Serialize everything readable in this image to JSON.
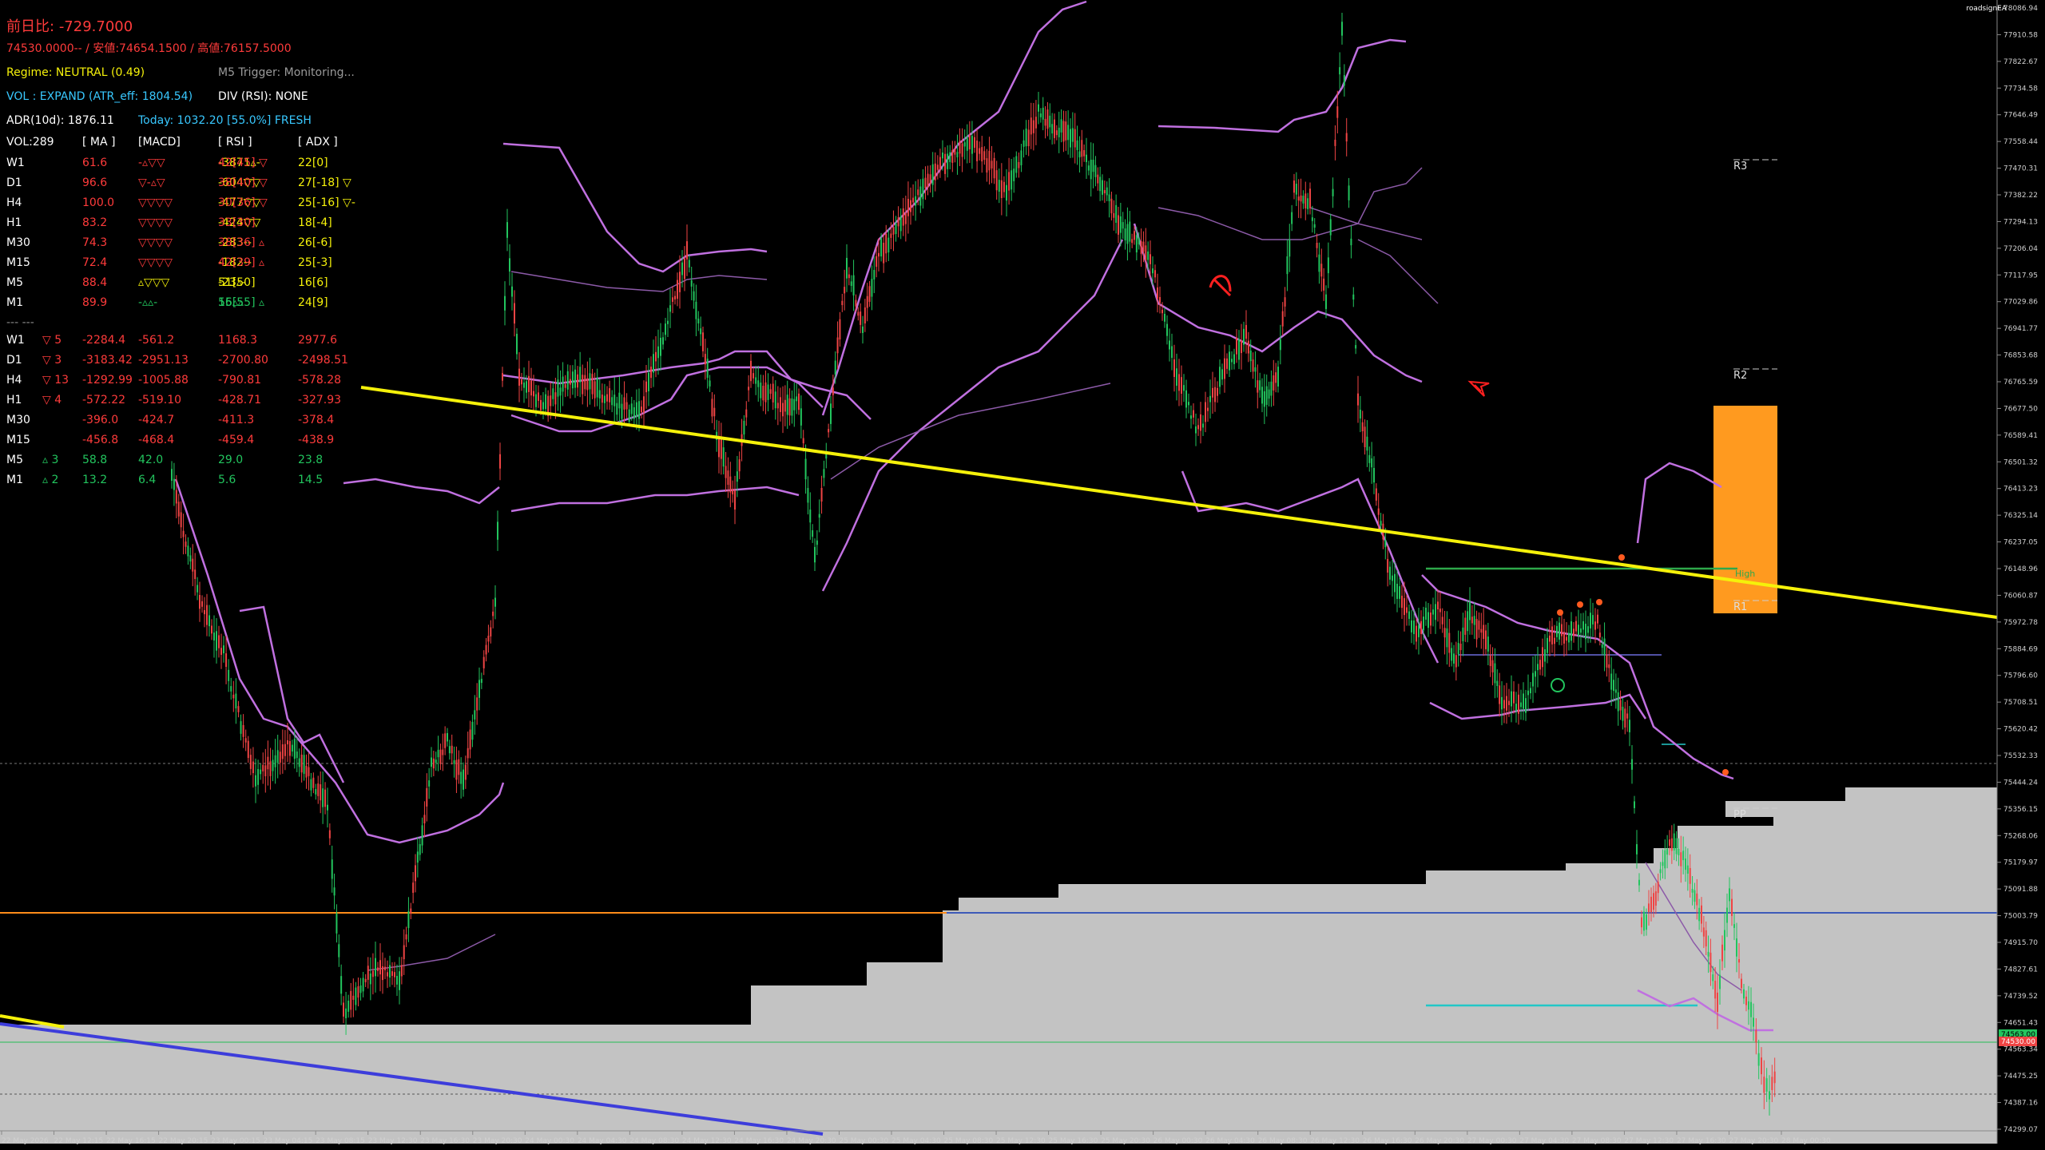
{
  "hud": {
    "change_label": "前日比:",
    "change_value": "-729.7000",
    "price_line": "74530.0000--   / 安値:74654.1500 / 高値:76157.5000",
    "regime": "Regime: NEUTRAL (0.49)",
    "m5_trigger": "M5 Trigger: Monitoring...",
    "vol": "VOL : EXPAND (ATR_eff: 1804.54)",
    "div": "DIV (RSI): NONE",
    "adr_label": "ADR(10d):",
    "adr_value": "1876.11",
    "today": "Today: 1032.20 [55.0%] FRESH"
  },
  "table": {
    "header": [
      "VOL:289",
      "[ MA ]",
      "[MACD]",
      "[ RSI ]",
      "[ ADX ]"
    ],
    "rows1": [
      {
        "tf": "W1",
        "vol": "61.6",
        "ma": "-▵▽▽",
        "macd": "-3871▵-",
        "rsi": "42[45] ▽",
        "adx": "22[0]"
      },
      {
        "tf": "D1",
        "vol": "96.6",
        "ma": "▽-▵▽",
        "macd": "-604▽▽",
        "rsi": "38[40] ▽",
        "adx": "27[-18] ▽"
      },
      {
        "tf": "H4",
        "vol": "100.0",
        "ma": "▽▽▽▽",
        "macd": "-477▽▽",
        "rsi": "30[36] ▽",
        "adx": "25[-16] ▽-"
      },
      {
        "tf": "H1",
        "vol": "83.2",
        "ma": "▽▽▽▽",
        "macd": "-424▽▽",
        "rsi": "33[30]",
        "adx": "18[-4]"
      },
      {
        "tf": "M30",
        "vol": "74.3",
        "ma": "▽▽▽▽",
        "macd": "-283--",
        "rsi": "38[36] ▵",
        "adx": "26[-6]"
      },
      {
        "tf": "M15",
        "vol": "72.4",
        "ma": "▽▽▽▽",
        "macd": "-182--",
        "rsi": "42[39] ▵",
        "adx": "25[-3]"
      },
      {
        "tf": "M5",
        "vol": "88.4",
        "ma": "▵▽▽▽",
        "macd": "-23▵-",
        "rsi": "51[50]",
        "adx": "16[6]"
      },
      {
        "tf": "M1",
        "vol": "89.9",
        "ma": "-▵▵-",
        "macd": "15▵▵",
        "rsi": "56[55] ▵",
        "adx": "24[9]"
      }
    ],
    "sep": "--- ---",
    "rows2": [
      {
        "tf": "W1",
        "cnt": "▽ 5",
        "a": "-2284.4",
        "b": "-561.2",
        "c": "1168.3",
        "d": "2977.6"
      },
      {
        "tf": "D1",
        "cnt": "▽ 3",
        "a": "-3183.42",
        "b": "-2951.13",
        "c": "-2700.80",
        "d": "-2498.51"
      },
      {
        "tf": "H4",
        "cnt": "▽ 13",
        "a": "-1292.99",
        "b": "-1005.88",
        "c": "-790.81",
        "d": "-578.28"
      },
      {
        "tf": "H1",
        "cnt": "▽ 4",
        "a": "-572.22",
        "b": "-519.10",
        "c": "-428.71",
        "d": "-327.93"
      },
      {
        "tf": "M30",
        "cnt": "",
        "a": "-396.0",
        "b": "-424.7",
        "c": "-411.3",
        "d": "-378.4"
      },
      {
        "tf": "M15",
        "cnt": "",
        "a": "-456.8",
        "b": "-468.4",
        "c": "-459.4",
        "d": "-438.9"
      },
      {
        "tf": "M5",
        "cnt": "▵ 3",
        "a": "58.8",
        "b": "42.0",
        "c": "29.0",
        "d": "23.8"
      },
      {
        "tf": "M1",
        "cnt": "▵ 2",
        "a": "13.2",
        "b": "6.4",
        "c": "5.6",
        "d": "14.5"
      }
    ]
  },
  "corner_tag": "roadsignEA",
  "price_axis": [
    "78086.94",
    "77910.58",
    "77822.67",
    "77734.58",
    "77646.49",
    "77558.44",
    "77470.31",
    "77382.22",
    "77294.13",
    "77206.04",
    "77117.95",
    "77029.86",
    "76941.77",
    "76853.68",
    "76765.59",
    "76677.50",
    "76589.41",
    "76501.32",
    "76413.23",
    "76325.14",
    "76237.05",
    "76148.96",
    "76060.87",
    "75972.78",
    "75884.69",
    "75796.60",
    "75708.51",
    "75620.42",
    "75532.33",
    "75444.24",
    "75356.15",
    "75268.06",
    "75179.97",
    "75091.88",
    "75003.79",
    "74915.70",
    "74827.61",
    "74739.52",
    "74651.43",
    "74563.34",
    "74475.25",
    "74387.16",
    "74299.07"
  ],
  "current_price_tags": [
    "74563.00",
    "74530.00"
  ],
  "time_axis": [
    "22 May 2026",
    "22 May 12:15",
    "22 May 16:15",
    "22 May 20:15",
    "23 May 00:15",
    "23 May 04:15",
    "23 May 08:15",
    "23 May 12:30",
    "23 May 16:30",
    "23 May 20:30",
    "24 May 00:30",
    "24 May 04:30",
    "24 May 08:30",
    "24 May 12:30",
    "24 May 16:30",
    "24 May 20:30",
    "25 May 00:30",
    "25 May 04:30",
    "25 May 08:30",
    "25 May 12:30",
    "25 May 16:30",
    "25 May 20:30",
    "26 May 00:30",
    "26 May 04:30",
    "26 May 08:30",
    "26 May 12:30",
    "26 May 16:30",
    "26 May 20:30",
    "27 May 00:30",
    "27 May 04:30",
    "27 May 08:30",
    "27 May 12:30",
    "27 May 16:30",
    "27 May 20:30",
    "28 May 00:30"
  ],
  "levels": {
    "r3": "R3",
    "r2": "R2",
    "r1": "R1",
    "pp": "PP",
    "high": "High"
  },
  "colors": {
    "up": "#22c55e",
    "down": "#ef4444",
    "band": "#c070e0",
    "trend": "#f5f10a",
    "zone": "#ff9a1f",
    "gray": "#c3c3c3",
    "blue": "#3d3ddb",
    "cyan": "#22c7c7"
  }
}
